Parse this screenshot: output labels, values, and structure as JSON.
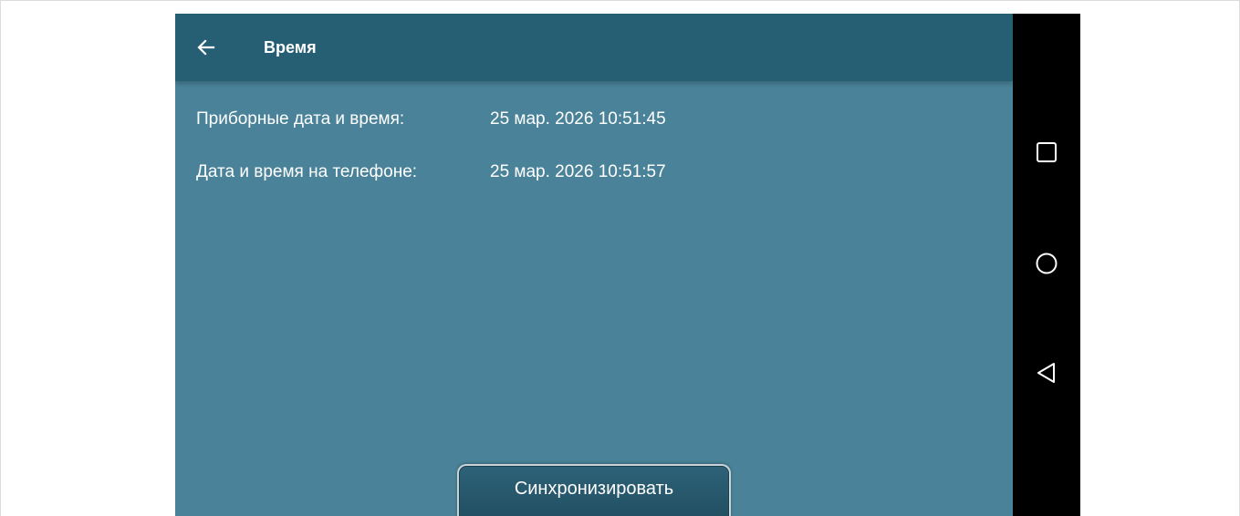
{
  "toolbar": {
    "title": "Время",
    "back_icon": "arrow-left-icon"
  },
  "rows": [
    {
      "label": "Приборные дата и время:",
      "value": "25 мар. 2026 10:51:45"
    },
    {
      "label": "Дата и время на телефоне:",
      "value": "25 мар. 2026 10:51:57"
    }
  ],
  "actions": {
    "sync_label": "Синхронизировать"
  },
  "navigation": {
    "recents_icon": "square-icon",
    "home_icon": "circle-icon",
    "back_icon": "triangle-back-icon"
  },
  "colors": {
    "toolbar": "#265f74",
    "content_background": "#4a8399",
    "button": "#265f74",
    "nav_bar": "#000000",
    "text": "#ffffff"
  }
}
